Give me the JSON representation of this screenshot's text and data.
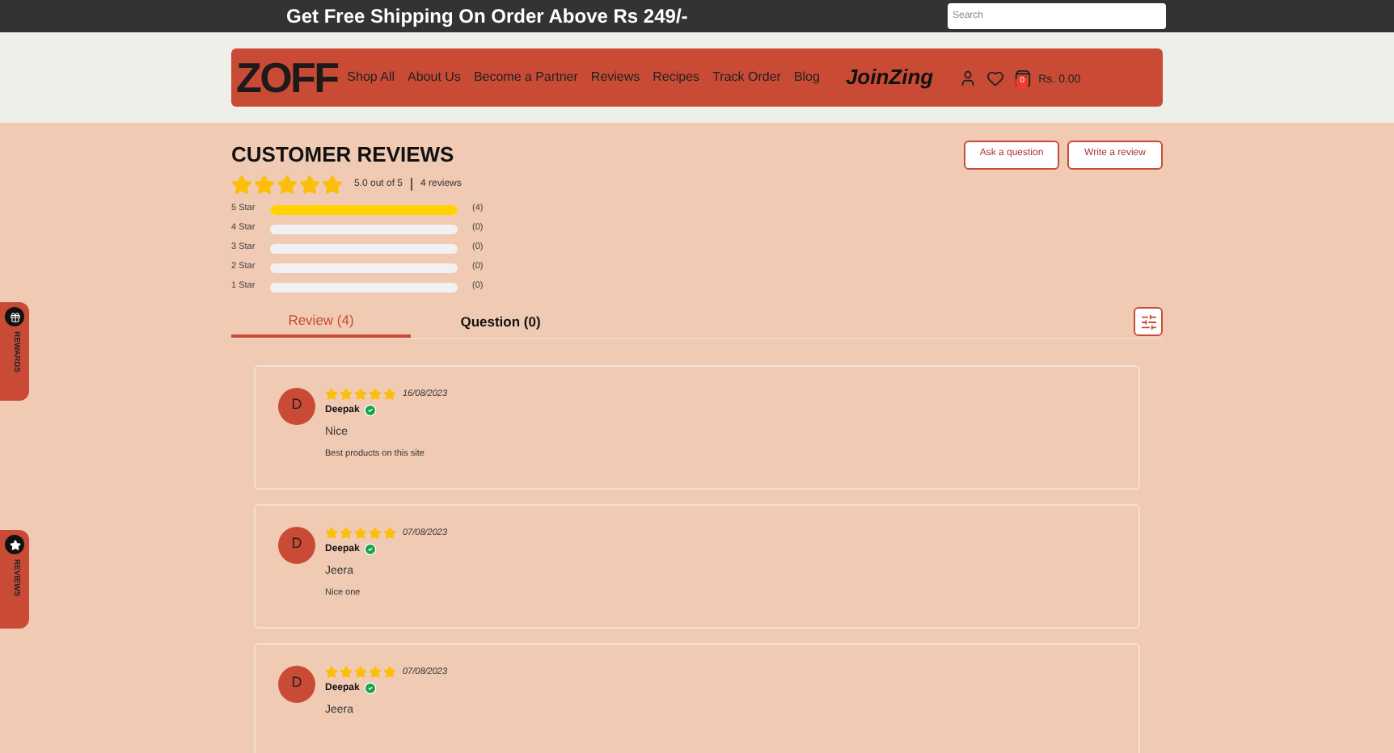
{
  "announcement": "Get Free Shipping On Order Above Rs 249/-",
  "search": {
    "placeholder": "Search"
  },
  "header": {
    "logo": "ZOFF",
    "nav": [
      "Shop All",
      "About Us",
      "Become a Partner",
      "Reviews",
      "Recipes",
      "Track Order",
      "Blog"
    ],
    "promo_logo": "JoinZing",
    "cart_count": "0",
    "cart_total": "Rs. 0.00"
  },
  "side_tabs": [
    {
      "label": "REWARDS",
      "kind": "gift"
    },
    {
      "label": "REVIEWS",
      "kind": "star"
    }
  ],
  "reviews_section": {
    "title": "CUSTOMER REVIEWS",
    "buttons": [
      "Ask a question",
      "Write a review"
    ],
    "stars": 5,
    "average": "5.0 out of 5",
    "count": "4 reviews",
    "distribution": [
      {
        "label": "5 Star",
        "level": 1,
        "count": "(4)"
      },
      {
        "label": "4 Star",
        "level": 0,
        "count": "(0)"
      },
      {
        "label": "3 Star",
        "level": 0,
        "count": "(0)"
      },
      {
        "label": "2 Star",
        "level": 0,
        "count": "(0)"
      },
      {
        "label": "1 Star",
        "level": 0,
        "count": "(0)"
      }
    ],
    "tabs": [
      {
        "label": "Review (4)",
        "selected": true
      },
      {
        "label": "Question (0)",
        "selected": false
      }
    ],
    "reviews": [
      {
        "initial": "D",
        "stars": 5,
        "date": "16/08/2023",
        "author": "Deepak",
        "verified": true,
        "title": "Nice",
        "body": "Best products on this site"
      },
      {
        "initial": "D",
        "stars": 5,
        "date": "07/08/2023",
        "author": "Deepak",
        "verified": true,
        "title": "Jeera",
        "body": "Nice one"
      },
      {
        "initial": "D",
        "stars": 5,
        "date": "07/08/2023",
        "author": "Deepak",
        "verified": true,
        "title": "Jeera"
      }
    ]
  }
}
